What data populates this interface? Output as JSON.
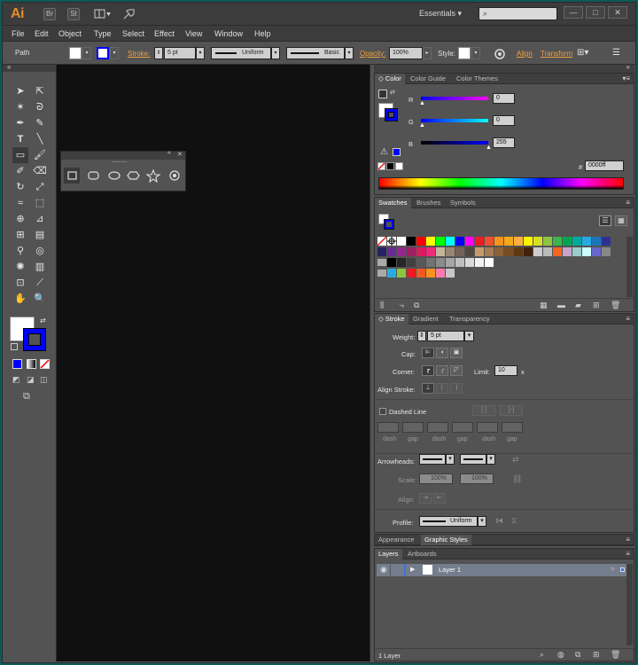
{
  "app": {
    "logo": "Ai",
    "bridge": "Br",
    "stock": "St",
    "workspace": "Essentials",
    "search_placeholder": "",
    "win_min": "—",
    "win_max": "□",
    "win_close": "✕"
  },
  "menu": [
    "File",
    "Edit",
    "Object",
    "Type",
    "Select",
    "Effect",
    "View",
    "Window",
    "Help"
  ],
  "control": {
    "selection": "Path",
    "stroke_label": "Stroke:",
    "stroke_weight": "5 pt",
    "profile1": "Uniform",
    "brush": "Basic",
    "opacity_label": "Opacity:",
    "opacity": "100%",
    "style_label": "Style:",
    "align": "Align",
    "transform": "Transform"
  },
  "color_panel": {
    "tabs": [
      "Color",
      "Color Guide",
      "Color Themes"
    ],
    "r_label": "R",
    "r": "0",
    "g_label": "G",
    "g": "0",
    "b_label": "B",
    "b": "255",
    "hex_prefix": "#",
    "hex": "0000ff",
    "stroke_color": "#0000ff"
  },
  "swatches_panel": {
    "tabs": [
      "Swatches",
      "Brushes",
      "Symbols"
    ]
  },
  "stroke_panel": {
    "tabs": [
      "Stroke",
      "Gradient",
      "Transparency"
    ],
    "weight_label": "Weight:",
    "weight": "5 pt",
    "cap_label": "Cap:",
    "corner_label": "Corner:",
    "limit_label": "Limit:",
    "limit": "10",
    "limit_x": "x",
    "align_label": "Align Stroke:",
    "dashed_label": "Dashed Line",
    "dash_labels": [
      "dash",
      "gap",
      "dash",
      "gap",
      "dash",
      "gap"
    ],
    "arrowheads_label": "Arrowheads:",
    "scale_label": "Scale:",
    "scale1": "100%",
    "scale2": "100%",
    "align2_label": "Align:",
    "profile_label": "Profile:",
    "profile": "Uniform"
  },
  "appearance_panel": {
    "tabs": [
      "Appearance",
      "Graphic Styles"
    ]
  },
  "layers_panel": {
    "tabs": [
      "Layers",
      "Artboards"
    ],
    "layer_name": "Layer 1",
    "footer": "1 Layer"
  }
}
